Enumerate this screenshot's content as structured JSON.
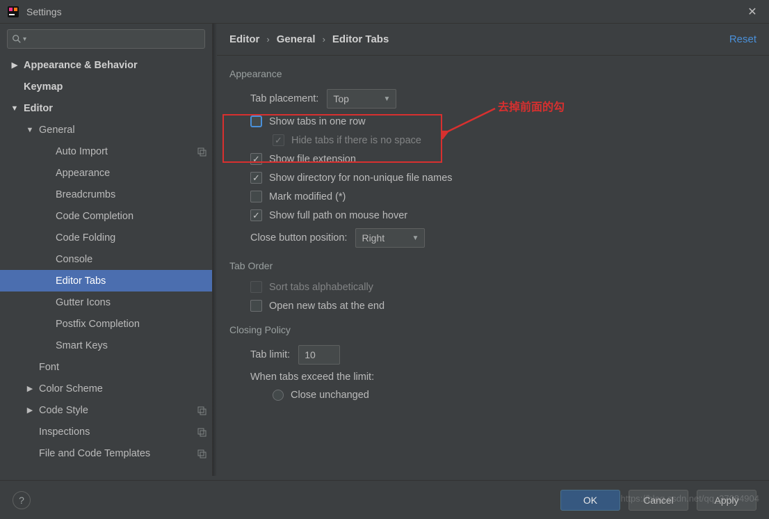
{
  "titlebar": {
    "title": "Settings"
  },
  "sidebar": {
    "items": [
      {
        "label": "Appearance & Behavior",
        "depth": 0,
        "bold": true,
        "twist": "▶",
        "copy": false
      },
      {
        "label": "Keymap",
        "depth": 0,
        "bold": true,
        "twist": "",
        "copy": false
      },
      {
        "label": "Editor",
        "depth": 0,
        "bold": true,
        "twist": "▼",
        "copy": false
      },
      {
        "label": "General",
        "depth": 1,
        "bold": false,
        "twist": "▼",
        "copy": false
      },
      {
        "label": "Auto Import",
        "depth": 2,
        "bold": false,
        "twist": "",
        "copy": true
      },
      {
        "label": "Appearance",
        "depth": 2,
        "bold": false,
        "twist": "",
        "copy": false
      },
      {
        "label": "Breadcrumbs",
        "depth": 2,
        "bold": false,
        "twist": "",
        "copy": false
      },
      {
        "label": "Code Completion",
        "depth": 2,
        "bold": false,
        "twist": "",
        "copy": false
      },
      {
        "label": "Code Folding",
        "depth": 2,
        "bold": false,
        "twist": "",
        "copy": false
      },
      {
        "label": "Console",
        "depth": 2,
        "bold": false,
        "twist": "",
        "copy": false
      },
      {
        "label": "Editor Tabs",
        "depth": 2,
        "bold": false,
        "twist": "",
        "copy": false,
        "selected": true
      },
      {
        "label": "Gutter Icons",
        "depth": 2,
        "bold": false,
        "twist": "",
        "copy": false
      },
      {
        "label": "Postfix Completion",
        "depth": 2,
        "bold": false,
        "twist": "",
        "copy": false
      },
      {
        "label": "Smart Keys",
        "depth": 2,
        "bold": false,
        "twist": "",
        "copy": false
      },
      {
        "label": "Font",
        "depth": 1,
        "bold": false,
        "twist": "",
        "copy": false
      },
      {
        "label": "Color Scheme",
        "depth": 1,
        "bold": false,
        "twist": "▶",
        "copy": false
      },
      {
        "label": "Code Style",
        "depth": 1,
        "bold": false,
        "twist": "▶",
        "copy": true
      },
      {
        "label": "Inspections",
        "depth": 1,
        "bold": false,
        "twist": "",
        "copy": true
      },
      {
        "label": "File and Code Templates",
        "depth": 1,
        "bold": false,
        "twist": "",
        "copy": true
      }
    ]
  },
  "breadcrumb": {
    "a": "Editor",
    "b": "General",
    "c": "Editor Tabs",
    "reset": "Reset"
  },
  "sections": {
    "appearance": {
      "title": "Appearance",
      "tab_placement_label": "Tab placement:",
      "tab_placement_value": "Top",
      "show_one_row": "Show tabs in one row",
      "hide_tabs": "Hide tabs if there is no space",
      "show_ext": "Show file extension",
      "show_dir": "Show directory for non-unique file names",
      "mark_mod": "Mark modified (*)",
      "full_path": "Show full path on mouse hover",
      "close_btn_label": "Close button position:",
      "close_btn_value": "Right"
    },
    "taborder": {
      "title": "Tab Order",
      "sort": "Sort tabs alphabetically",
      "open_end": "Open new tabs at the end"
    },
    "closing": {
      "title": "Closing Policy",
      "tab_limit_label": "Tab limit:",
      "tab_limit_value": "10",
      "exceed_label": "When tabs exceed the limit:",
      "close_unchanged": "Close unchanged"
    }
  },
  "annotation": {
    "text": "去掉前面的勾"
  },
  "footer": {
    "ok": "OK",
    "cancel": "Cancel",
    "apply": "Apply"
  },
  "watermark": "https://blog.csdn.net/qq_37084904"
}
